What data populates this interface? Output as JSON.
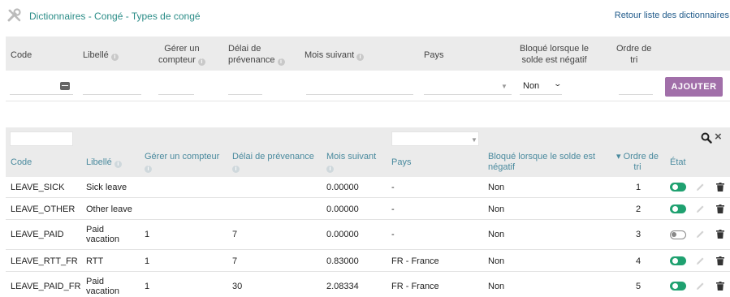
{
  "header": {
    "title": "Dictionnaires - Congé - Types de congé",
    "back_link": "Retour liste des dictionnaires",
    "tools_icon": "tools-icon"
  },
  "form": {
    "columns": {
      "code": "Code",
      "libelle": "Libellé",
      "gerer_1": "Gérer un",
      "gerer_2": "compteur",
      "delai_1": "Délai de",
      "delai_2": "prévenance",
      "mois": "Mois suivant",
      "pays": "Pays",
      "bloque_1": "Bloqué lorsque le",
      "bloque_2": "solde est négatif",
      "ordre_1": "Ordre de",
      "ordre_2": "tri"
    },
    "bloque_value": "Non",
    "add_label": "AJOUTER"
  },
  "table": {
    "columns": {
      "code": "Code",
      "libelle": "Libellé",
      "gerer": "Gérer un compteur",
      "delai": "Délai de prévenance",
      "mois": "Mois suivant",
      "pays": "Pays",
      "bloque_1": "Bloqué lorsque le solde est",
      "bloque_2": "négatif",
      "ordre_1": "▾ Ordre de",
      "ordre_2": "tri",
      "etat": "État"
    },
    "rows": [
      {
        "code": "LEAVE_SICK",
        "libelle": "Sick leave",
        "gerer": "",
        "delai": "",
        "mois": "0.00000",
        "pays": "-",
        "bloque": "Non",
        "ordre": "1",
        "active": true
      },
      {
        "code": "LEAVE_OTHER",
        "libelle": "Other leave",
        "gerer": "",
        "delai": "",
        "mois": "0.00000",
        "pays": "-",
        "bloque": "Non",
        "ordre": "2",
        "active": true
      },
      {
        "code": "LEAVE_PAID",
        "libelle_1": "Paid",
        "libelle_2": "vacation",
        "gerer": "1",
        "delai": "7",
        "mois": "0.00000",
        "pays": "-",
        "bloque": "Non",
        "ordre": "3",
        "active": false
      },
      {
        "code": "LEAVE_RTT_FR",
        "libelle": "RTT",
        "gerer": "1",
        "delai": "7",
        "mois": "0.83000",
        "pays": "FR - France",
        "bloque": "Non",
        "ordre": "4",
        "active": true
      },
      {
        "code": "LEAVE_PAID_FR",
        "libelle_1": "Paid",
        "libelle_2": "vacation",
        "gerer": "1",
        "delai": "30",
        "mois": "2.08334",
        "pays": "FR - France",
        "bloque": "Non",
        "ordre": "5",
        "active": true
      }
    ]
  }
}
